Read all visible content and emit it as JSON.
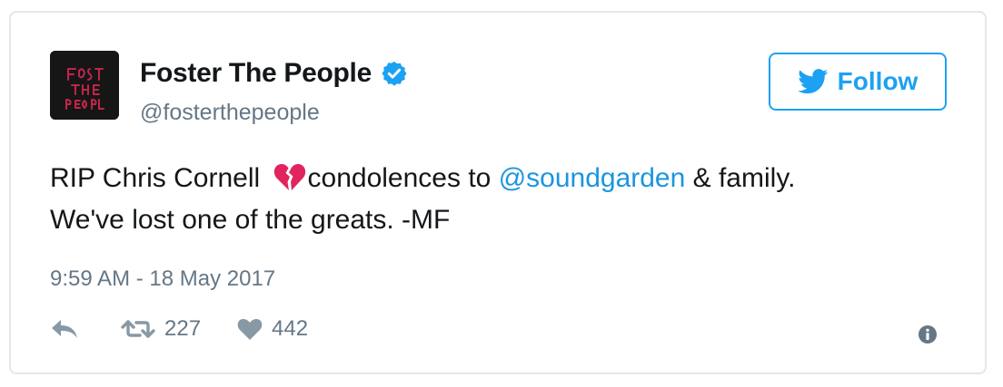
{
  "author": {
    "display_name": "Foster The People",
    "handle": "@fosterthepeople",
    "verified": true,
    "avatar_icon": "band-logo-avatar",
    "avatar_text": "FOSTER THE PEOPLE"
  },
  "follow_button": {
    "label": "Follow",
    "icon": "twitter-bird-icon",
    "color": "#1da1f2"
  },
  "tweet": {
    "text_part1": "RIP Chris Cornell ",
    "emoji": "broken-heart",
    "text_part2": "condolences to ",
    "mention": "@soundgarden",
    "text_part3": " & family.",
    "line2": "We've lost one of the greats. -MF",
    "timestamp": "9:59 AM - 18 May 2017"
  },
  "actions": {
    "retweet_count": "227",
    "like_count": "442"
  },
  "colors": {
    "link": "#1b95e0",
    "muted": "#657786",
    "border": "#e1e8ed",
    "broken_heart": "#e0245e"
  }
}
